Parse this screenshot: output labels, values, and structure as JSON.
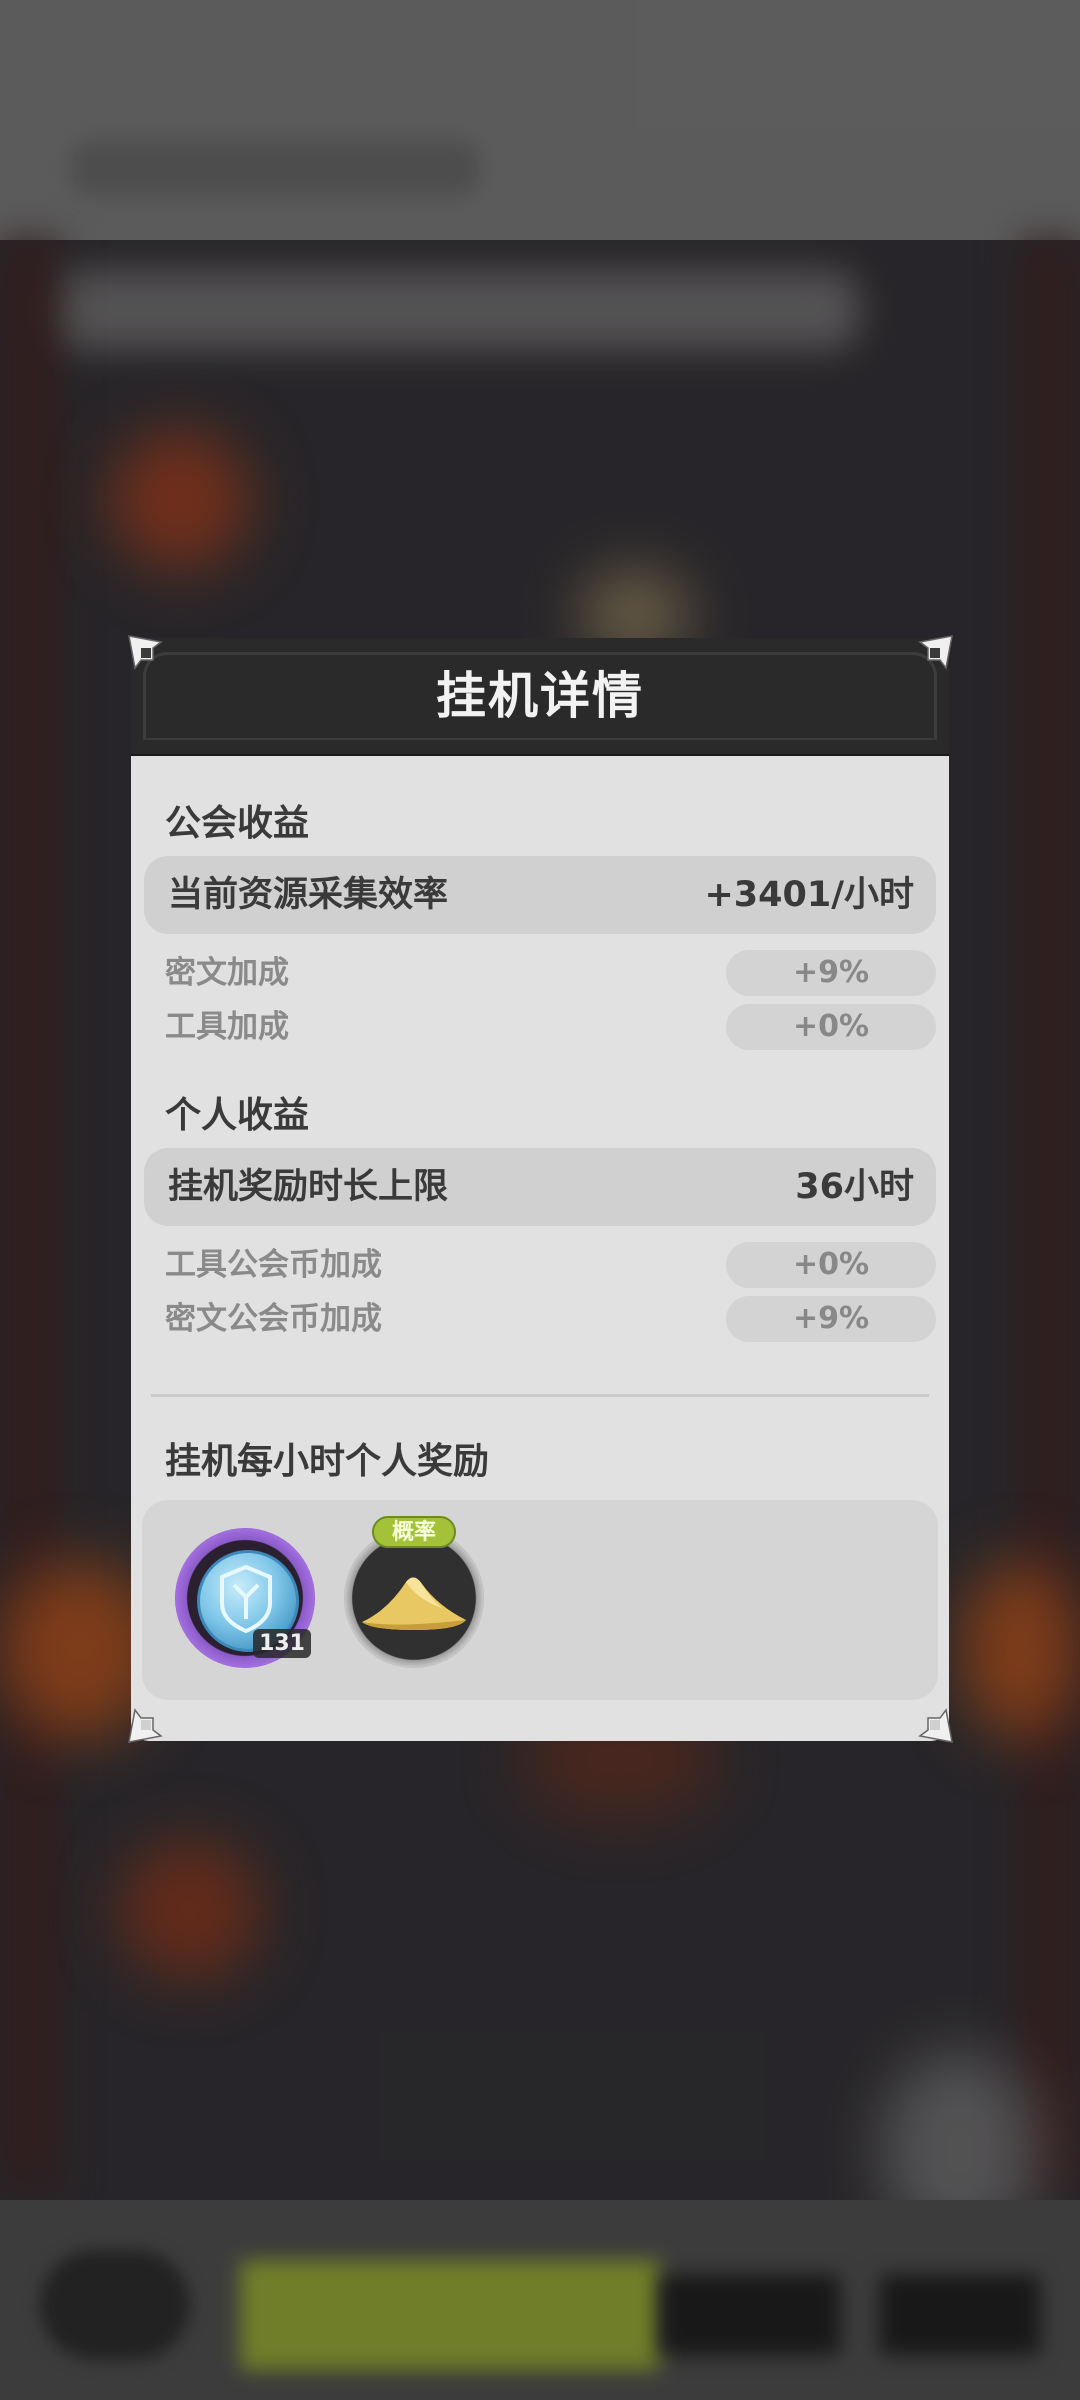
{
  "modal": {
    "title": "挂机详情",
    "guild_section": {
      "title": "公会收益",
      "main_row": {
        "label": "当前资源采集效率",
        "value": "+3401/小时"
      },
      "rows": [
        {
          "label": "密文加成",
          "value": "+9%"
        },
        {
          "label": "工具加成",
          "value": "+0%"
        }
      ]
    },
    "personal_section": {
      "title": "个人收益",
      "main_row": {
        "label": "挂机奖励时长上限",
        "value": "36小时"
      },
      "rows": [
        {
          "label": "工具公会币加成",
          "value": "+0%"
        },
        {
          "label": "密文公会币加成",
          "value": "+9%"
        }
      ]
    },
    "rewards_section": {
      "title": "挂机每小时个人奖励",
      "items": [
        {
          "icon": "guild-coin-icon",
          "count": "131",
          "tag": ""
        },
        {
          "icon": "sand-pile-icon",
          "count": "",
          "tag": "概率"
        }
      ]
    }
  },
  "colors": {
    "panel_bg": "#e1e1e1",
    "header_bg": "#2a2a2a",
    "highlight_row": "#d0d0d0",
    "probability_tag": "#a3c23a",
    "coin_ring": "#a36ee0"
  }
}
